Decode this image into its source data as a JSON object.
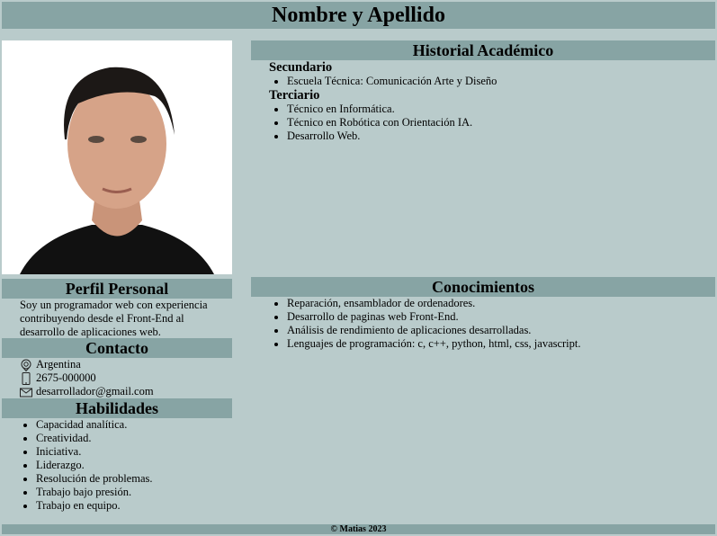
{
  "header": {
    "title": "Nombre y Apellido"
  },
  "profile": {
    "title": "Perfil Personal",
    "text": "Soy un programador web con experiencia contribuyendo desde el Front-End al desarrollo de aplicaciones web."
  },
  "contact": {
    "title": "Contacto",
    "items": [
      {
        "icon": "location-icon",
        "text": "Argentina"
      },
      {
        "icon": "phone-icon",
        "text": "2675-000000"
      },
      {
        "icon": "mail-icon",
        "text": "desarrollador@gmail.com"
      }
    ]
  },
  "skills": {
    "title": "Habilidades",
    "items": [
      "Capacidad analítica.",
      "Creatividad.",
      "Iniciativa.",
      "Liderazgo.",
      "Resolución de problemas.",
      "Trabajo bajo presión.",
      "Trabajo en equipo."
    ]
  },
  "academic": {
    "title": "Historial Académico",
    "secundario": {
      "label": "Secundario",
      "items": [
        "Escuela Técnica: Comunicación Arte y Diseño"
      ]
    },
    "terciario": {
      "label": "Terciario",
      "items": [
        "Técnico en Informática.",
        "Técnico en Robótica con Orientación IA.",
        "Desarrollo Web."
      ]
    }
  },
  "knowledge": {
    "title": "Conocimientos",
    "items": [
      "Reparación, ensamblador de ordenadores.",
      "Desarrollo de paginas web Front-End.",
      "Análisis de rendimiento de aplicaciones desarrolladas.",
      "Lenguajes de programación: c, c++, python, html, css, javascript."
    ]
  },
  "footer": {
    "text": "© Matias 2023"
  },
  "colors": {
    "background": "#b9cbcb",
    "bar": "#87a4a4"
  }
}
